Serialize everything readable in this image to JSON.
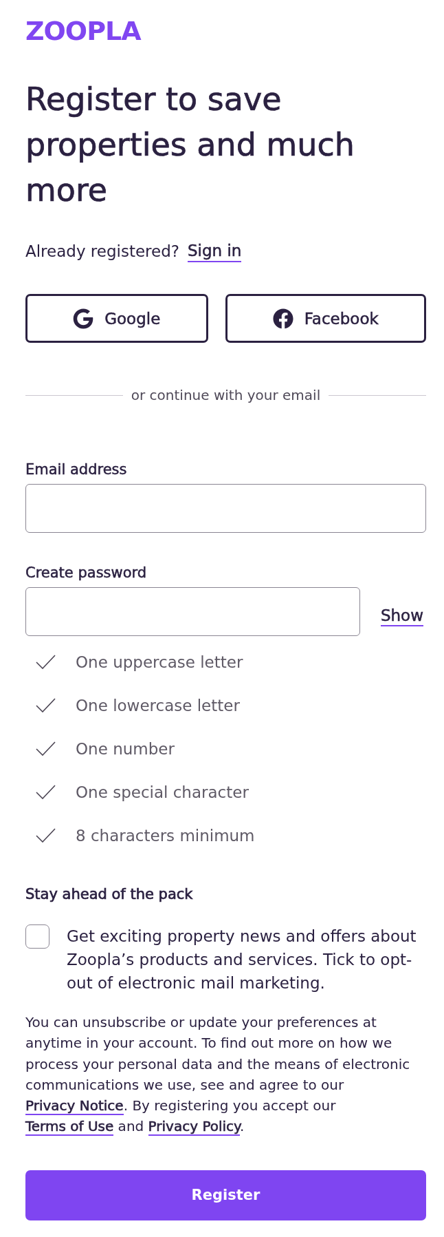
{
  "logo": {
    "text": "ZOOPLA"
  },
  "heading": "Register to save properties and much more",
  "sign_in": {
    "prompt": "Already registered?",
    "link": "Sign in"
  },
  "social_buttons": [
    {
      "kind": "google",
      "label": "Google"
    },
    {
      "kind": "facebook",
      "label": "Facebook"
    }
  ],
  "divider": "or continue with your email",
  "fields": [
    {
      "kind": "email",
      "label": "Email address"
    },
    {
      "kind": "password",
      "label": "Create password",
      "toggle": "Show"
    }
  ],
  "password_rules": [
    "One uppercase letter",
    "One lowercase letter",
    "One number",
    "One special character",
    "8 characters minimum"
  ],
  "marketing": {
    "title": "Stay ahead of the pack",
    "checked": false,
    "text": "Get exciting property news and offers about Zoopla’s products and services. Tick to opt-out of electronic mail marketing."
  },
  "legal": [
    {
      "kind": "text",
      "text": "You can unsubscribe or update your preferences at anytime in your account. To find out more on how we process your personal data and the means of electronic communications we use, see and agree to our "
    },
    {
      "kind": "link",
      "text": "Privacy Notice"
    },
    {
      "kind": "text",
      "text": ". By registering you accept our "
    },
    {
      "kind": "link",
      "text": "Terms of Use"
    },
    {
      "kind": "text",
      "text": " and "
    },
    {
      "kind": "link",
      "text": "Privacy Policy"
    },
    {
      "kind": "text",
      "text": "."
    }
  ],
  "submit": {
    "label": "Register"
  }
}
